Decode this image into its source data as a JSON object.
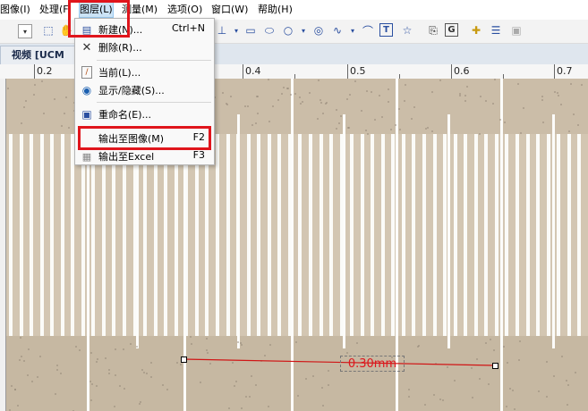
{
  "menubar": [
    {
      "label": "图像(I)"
    },
    {
      "label": "处理(F"
    },
    {
      "label": "图层(L)"
    },
    {
      "label": "测量(M)"
    },
    {
      "label": "选项(O)"
    },
    {
      "label": "窗口(W)"
    },
    {
      "label": "帮助(H)"
    }
  ],
  "tab": {
    "label": "视频 [UCM"
  },
  "ruler": {
    "ticks": [
      "0.2",
      "0.4",
      "0.5",
      "0.6",
      "0.7"
    ]
  },
  "layer_menu": {
    "items": [
      {
        "label": "新建(N)...",
        "shortcut": "Ctrl+N",
        "icon": "new-layer-icon"
      },
      {
        "label": "删除(R)...",
        "shortcut": "",
        "icon": "delete-icon"
      },
      {
        "label": "当前(L)...",
        "shortcut": "",
        "icon": "current-layer-icon"
      },
      {
        "label": "显示/隐藏(S)...",
        "shortcut": "",
        "icon": "eye-icon"
      },
      {
        "label": "重命名(E)...",
        "shortcut": "",
        "icon": "rename-icon"
      },
      {
        "label": "输出至图像(M)",
        "shortcut": "F2",
        "icon": ""
      },
      {
        "label": "输出至Excel",
        "shortcut": "F3",
        "icon": "excel-icon"
      }
    ]
  },
  "measurement": {
    "label": "0.30mm"
  },
  "colors": {
    "highlight": "#e0151c",
    "measure_line": "#d01515",
    "menu_active": "#cce4f7"
  }
}
